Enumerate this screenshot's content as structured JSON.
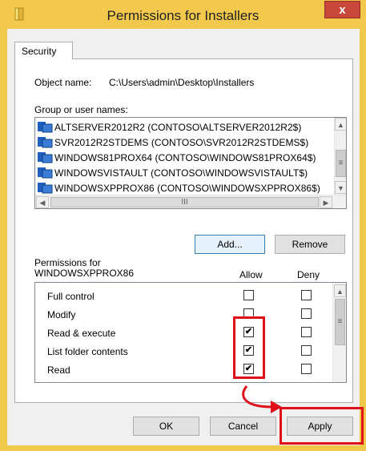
{
  "window": {
    "title": "Permissions for Installers",
    "close_glyph": "x",
    "folder_icon": "folder-icon",
    "frame_color": "#f2c94c"
  },
  "tab": {
    "label": "Security"
  },
  "object": {
    "label": "Object name:",
    "value": "C:\\Users\\admin\\Desktop\\Installers"
  },
  "groups": {
    "label": "Group or user names:",
    "items": [
      {
        "label": "ALTSERVER2012R2 (CONTOSO\\ALTSERVER2012R2$)",
        "icon": "user-group-icon"
      },
      {
        "label": "SVR2012R2STDEMS (CONTOSO\\SVR2012R2STDEMS$)",
        "icon": "user-group-icon"
      },
      {
        "label": "WINDOWS81PROX64 (CONTOSO\\WINDOWS81PROX64$)",
        "icon": "user-group-icon"
      },
      {
        "label": "WINDOWSVISTAULT (CONTOSO\\WINDOWSVISTAULT$)",
        "icon": "user-group-icon"
      },
      {
        "label": "WINDOWSXPPROX86 (CONTOSO\\WINDOWSXPPROX86$)",
        "icon": "user-group-icon"
      }
    ],
    "add_button": "Add...",
    "remove_button": "Remove",
    "hthumb_glyph": "III",
    "vthumb_glyph": "≡"
  },
  "permissions": {
    "header_line1": "Permissions for",
    "header_line2": "WINDOWSXPPROX86",
    "allow_label": "Allow",
    "deny_label": "Deny",
    "rows": [
      {
        "name": "Full control",
        "allow": false,
        "deny": false
      },
      {
        "name": "Modify",
        "allow": false,
        "deny": false
      },
      {
        "name": "Read & execute",
        "allow": true,
        "deny": false
      },
      {
        "name": "List folder contents",
        "allow": true,
        "deny": false
      },
      {
        "name": "Read",
        "allow": true,
        "deny": false
      }
    ],
    "check_glyph": "✔",
    "vthumb_glyph": "≡"
  },
  "footer": {
    "ok": "OK",
    "cancel": "Cancel",
    "apply": "Apply"
  },
  "annotation_color": "#e0101a"
}
